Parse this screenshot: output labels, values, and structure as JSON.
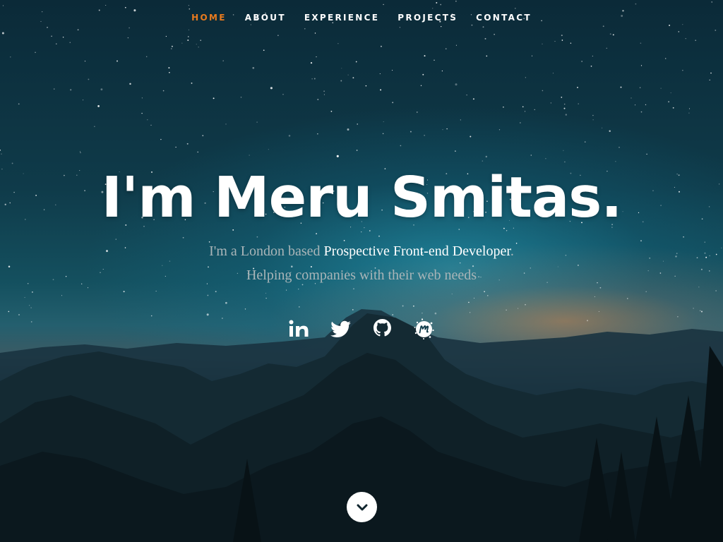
{
  "nav": {
    "items": [
      {
        "label": "HOME",
        "active": true
      },
      {
        "label": "ABOUT"
      },
      {
        "label": "EXPERIENCE"
      },
      {
        "label": "PROJECTS"
      },
      {
        "label": "CONTACT"
      }
    ],
    "active_color": "#e87a1e"
  },
  "hero": {
    "title": "I'm Meru Smitas.",
    "subtitle_prefix": "I'm a London based ",
    "subtitle_highlight": "Prospective Front-end Developer",
    "subtitle_suffix": ".",
    "tagline": "Helping companies with their web needs"
  },
  "social": [
    {
      "icon": "linkedin-icon"
    },
    {
      "icon": "twitter-icon"
    },
    {
      "icon": "github-icon"
    },
    {
      "icon": "meetup-icon"
    }
  ],
  "scroll": {
    "icon": "chevron-down-icon"
  }
}
